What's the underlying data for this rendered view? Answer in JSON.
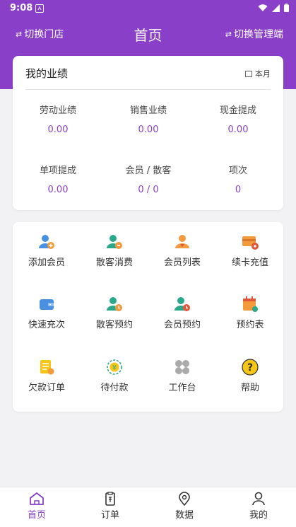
{
  "status_bar": {
    "time": "9:08",
    "notif_letter": "A"
  },
  "header": {
    "left_label": "切换门店",
    "title": "首页",
    "right_label": "切换管理端"
  },
  "performance": {
    "title": "我的业绩",
    "period": "本月",
    "stats": [
      {
        "label": "劳动业绩",
        "value": "0.00"
      },
      {
        "label": "销售业绩",
        "value": "0.00"
      },
      {
        "label": "现金提成",
        "value": "0.00"
      },
      {
        "label": "单项提成",
        "value": "0.00"
      },
      {
        "label": "会员 / 散客",
        "value": "0 / 0"
      },
      {
        "label": "项次",
        "value": "0"
      }
    ]
  },
  "shortcuts": [
    {
      "label": "添加会员",
      "icon": "add-member-icon"
    },
    {
      "label": "散客消费",
      "icon": "walkin-consume-icon"
    },
    {
      "label": "会员列表",
      "icon": "member-list-icon"
    },
    {
      "label": "续卡充值",
      "icon": "card-recharge-icon"
    },
    {
      "label": "快速充次",
      "icon": "wallet-icon"
    },
    {
      "label": "散客预约",
      "icon": "walkin-booking-icon"
    },
    {
      "label": "会员预约",
      "icon": "member-booking-icon"
    },
    {
      "label": "预约表",
      "icon": "calendar-icon"
    },
    {
      "label": "欠款订单",
      "icon": "debt-order-icon"
    },
    {
      "label": "待付款",
      "icon": "pending-payment-icon"
    },
    {
      "label": "工作台",
      "icon": "workbench-icon"
    },
    {
      "label": "帮助",
      "icon": "help-icon"
    }
  ],
  "tabs": [
    {
      "label": "首页",
      "icon": "home-icon",
      "active": true
    },
    {
      "label": "订单",
      "icon": "clipboard-icon",
      "active": false
    },
    {
      "label": "数据",
      "icon": "location-icon",
      "active": false
    },
    {
      "label": "我的",
      "icon": "user-icon",
      "active": false
    }
  ],
  "colors": {
    "accent": "#8a3fc8",
    "teal": "#2aa889",
    "orange": "#f39a3c",
    "blue": "#4a90e2",
    "gold": "#f5c518",
    "gray": "#aaaaaa"
  }
}
